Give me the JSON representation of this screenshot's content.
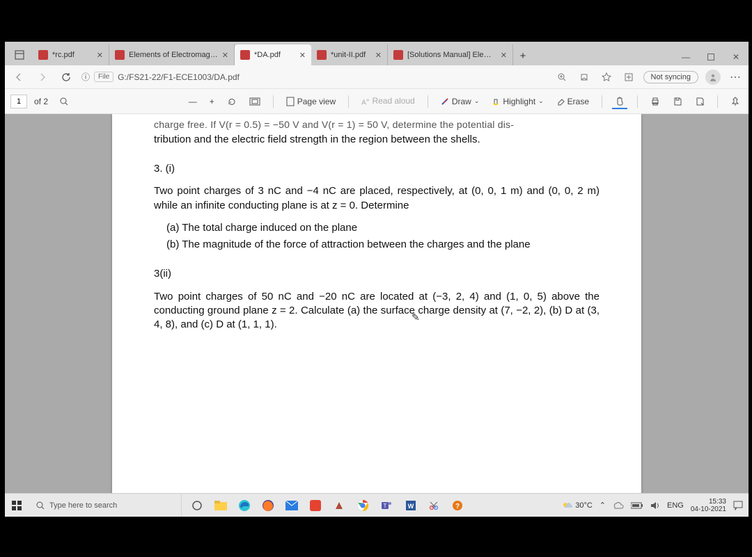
{
  "tabs": [
    {
      "label": "*rc.pdf"
    },
    {
      "label": "Elements of Electromagnetic"
    },
    {
      "label": "*DA.pdf"
    },
    {
      "label": "*unit-II.pdf"
    },
    {
      "label": "[Solutions Manual] Elements"
    }
  ],
  "addr": {
    "file_chip": "File",
    "info_icon": "ⓘ",
    "path": "G:/FS21-22/F1-ECE1003/DA.pdf",
    "not_syncing": "Not syncing"
  },
  "pdftb": {
    "page_current": "1",
    "page_of": "of 2",
    "page_view": "Page view",
    "read_aloud": "Read aloud",
    "draw": "Draw",
    "highlight": "Highlight",
    "erase": "Erase"
  },
  "doc": {
    "frag_top": "charge free. If V(r = 0.5) = −50 V and V(r = 1) = 50 V, determine the potential dis-",
    "frag_line2": "tribution and the electric field strength in the region between the shells.",
    "q3i_head": "3. (i)",
    "q3i_p1": "Two point charges of 3 nC and −4 nC are placed, respectively, at (0, 0, 1 m) and (0, 0, 2 m) while an infinite conducting plane is at z = 0. Determine",
    "q3i_a": "(a)  The total charge induced on the plane",
    "q3i_b": "(b)  The magnitude of the force of attraction between the charges and the plane",
    "q3ii_head": "3(ii)",
    "q3ii_p": "Two point charges of 50 nC and −20 nC are located at (−3, 2, 4) and (1, 0, 5) above the conducting ground plane z = 2. Calculate (a) the surface charge density at (7, −2, 2), (b) D at (3, 4, 8), and (c) D at (1, 1, 1)."
  },
  "taskbar": {
    "search_placeholder": "Type here to search",
    "weather": "30°C",
    "lang": "ENG",
    "time": "15:33",
    "date": "04-10-2021"
  }
}
